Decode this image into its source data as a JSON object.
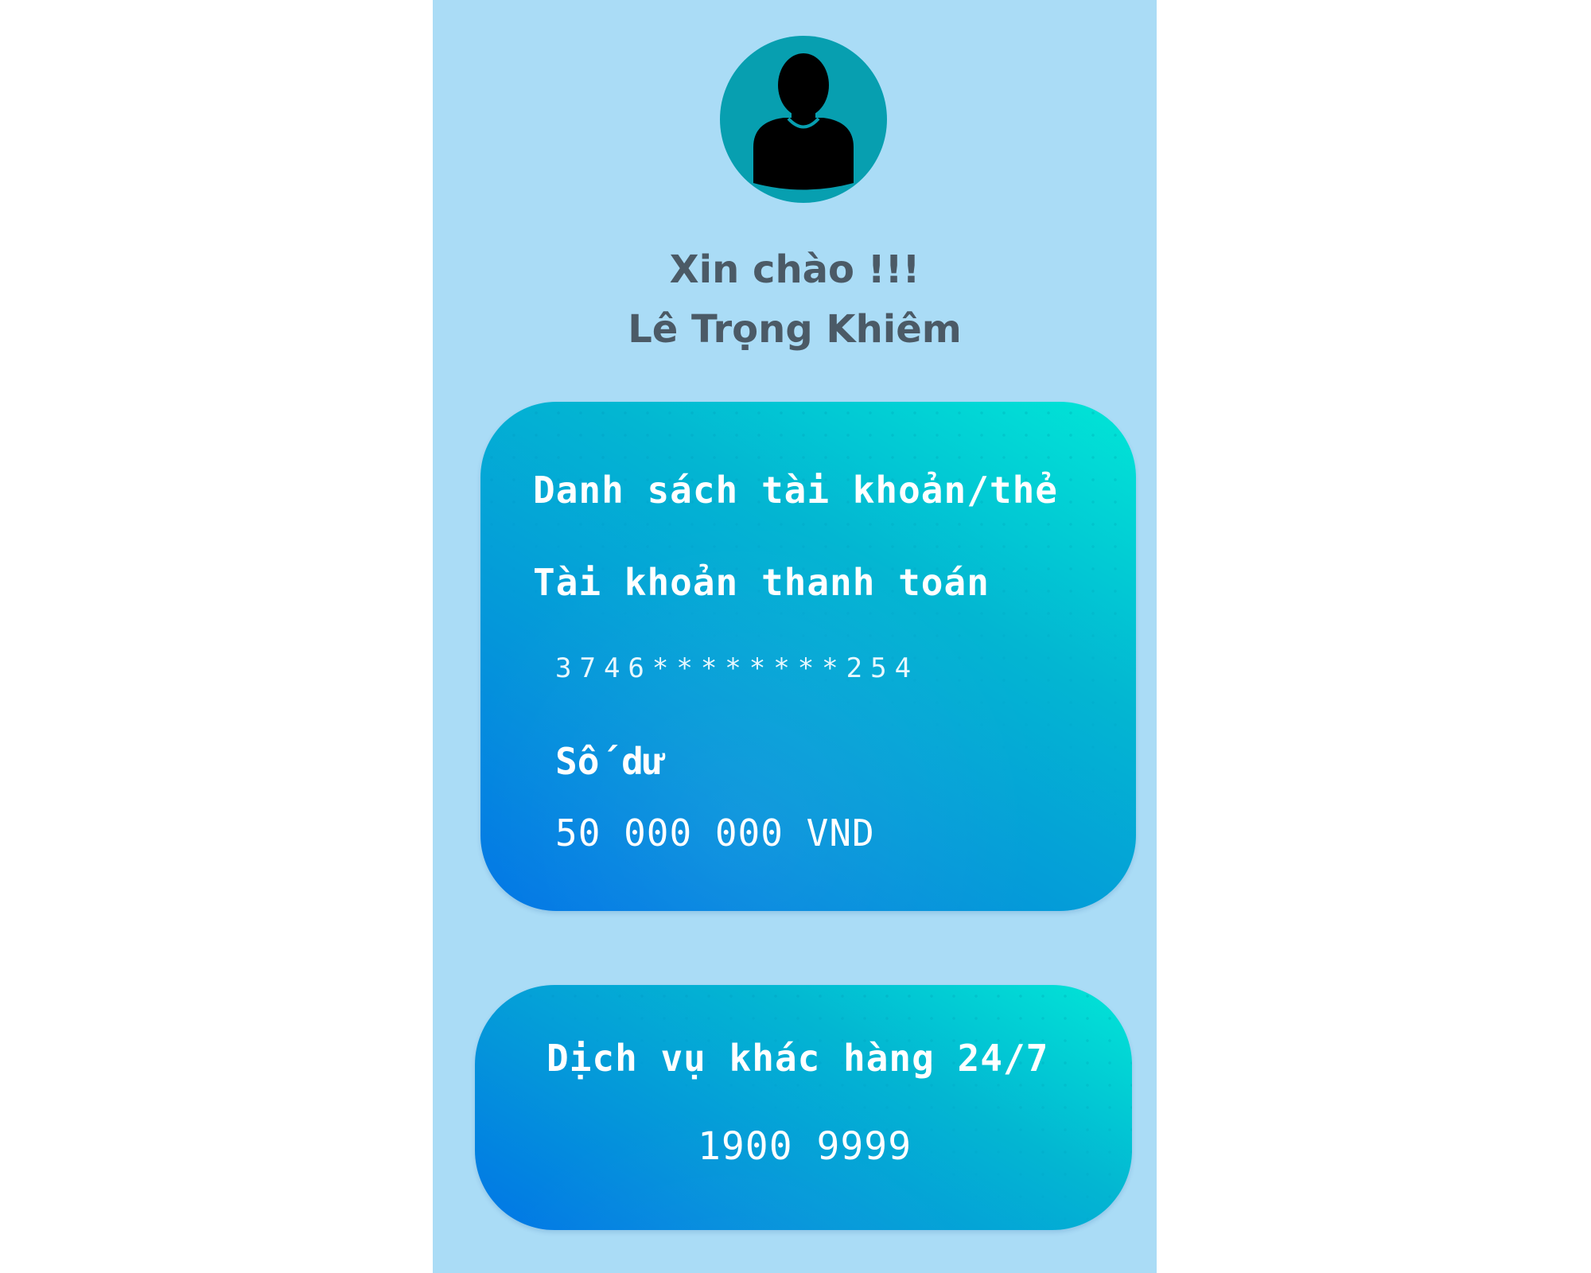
{
  "greeting": {
    "line1": "Xin chào !!!",
    "name": "Lê Trọng Khiêm",
    "avatar_icon": "user-icon"
  },
  "account_card": {
    "title": "Danh sách tài khoản/thẻ",
    "account_type": "Tài khoản thanh toán",
    "account_number": "3746********254",
    "balance_label": "Số dư",
    "balance_value": "50 000 000 VND"
  },
  "service_card": {
    "title": "Dịch vụ khác hàng 24/7",
    "phone": "1900 9999"
  },
  "colors": {
    "page_background": "#ffffff",
    "panel_background": "#aadcf6",
    "avatar_background": "#079fb0",
    "text_dark": "#4b5a66",
    "card_gradient_start": "#0175e6",
    "card_gradient_end": "#01e6d7"
  }
}
